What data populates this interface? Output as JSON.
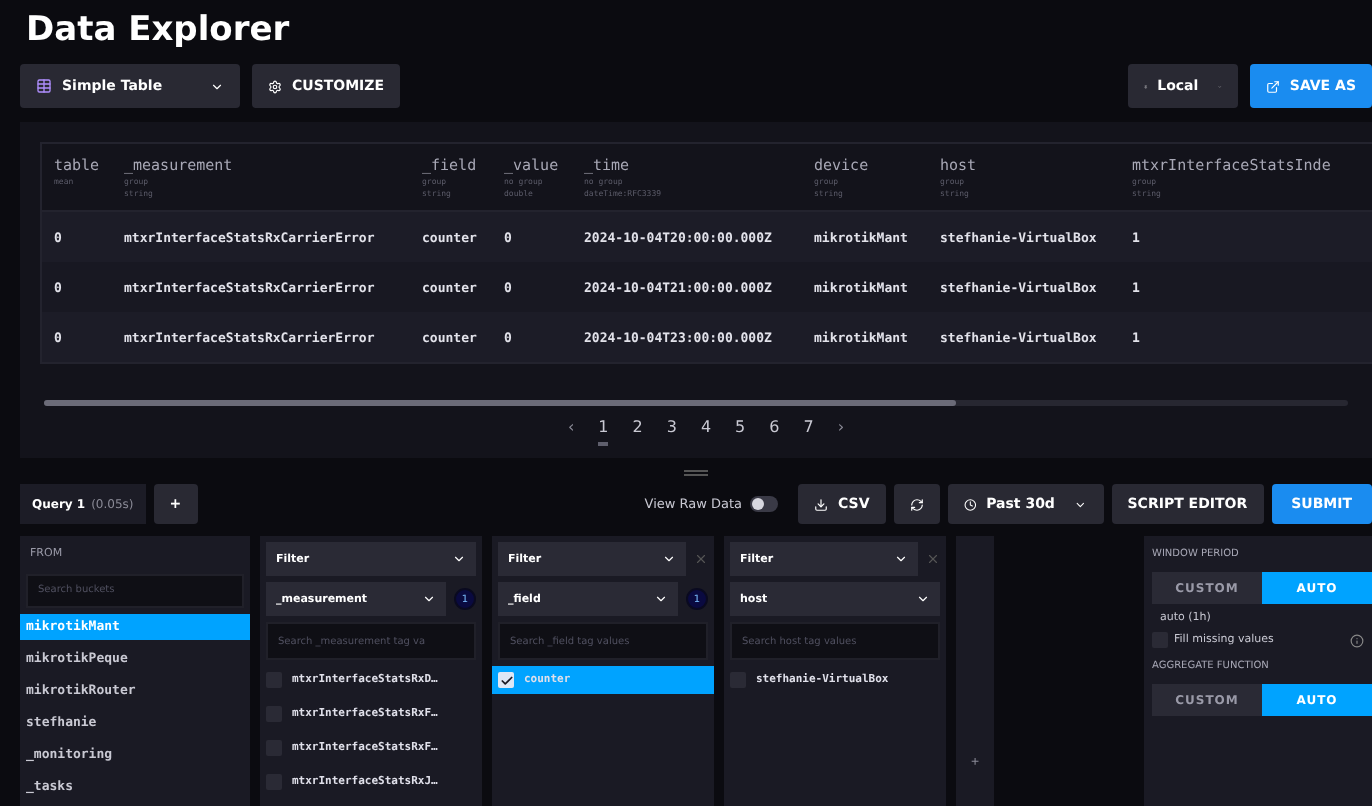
{
  "title": "Data Explorer",
  "toolbar": {
    "view_type": "Simple Table",
    "customize": "CUSTOMIZE",
    "timezone": "Local",
    "save_as": "SAVE AS"
  },
  "table": {
    "columns": [
      {
        "name": "table",
        "meta": [
          "mean"
        ]
      },
      {
        "name": "_measurement",
        "meta": [
          "group",
          "string"
        ]
      },
      {
        "name": "_field",
        "meta": [
          "group",
          "string"
        ]
      },
      {
        "name": "_value",
        "meta": [
          "no group",
          "double"
        ]
      },
      {
        "name": "_time",
        "meta": [
          "no group",
          "dateTime:RFC3339"
        ]
      },
      {
        "name": "device",
        "meta": [
          "group",
          "string"
        ]
      },
      {
        "name": "host",
        "meta": [
          "group",
          "string"
        ]
      },
      {
        "name": "mtxrInterfaceStatsInde",
        "meta": [
          "group",
          "string"
        ]
      }
    ],
    "rows": [
      [
        "0",
        "mtxrInterfaceStatsRxCarrierError",
        "counter",
        "0",
        "2024-10-04T20:00:00.000Z",
        "mikrotikMant",
        "stefhanie-VirtualBox",
        "1"
      ],
      [
        "0",
        "mtxrInterfaceStatsRxCarrierError",
        "counter",
        "0",
        "2024-10-04T21:00:00.000Z",
        "mikrotikMant",
        "stefhanie-VirtualBox",
        "1"
      ],
      [
        "0",
        "mtxrInterfaceStatsRxCarrierError",
        "counter",
        "0",
        "2024-10-04T23:00:00.000Z",
        "mikrotikMant",
        "stefhanie-VirtualBox",
        "1"
      ]
    ]
  },
  "pagination": {
    "prev": "‹",
    "next": "›",
    "pages": [
      {
        "label": "1",
        "selected": true
      },
      {
        "label": "2",
        "selected": false
      },
      {
        "label": "3",
        "selected": false
      },
      {
        "label": "4",
        "selected": false
      },
      {
        "label": "5",
        "selected": false
      },
      {
        "label": "6",
        "selected": false
      },
      {
        "label": "7",
        "selected": false
      }
    ]
  },
  "query_bar": {
    "tabs": [
      {
        "label": "Query 1",
        "timing": "(0.05s)",
        "selected": true
      }
    ],
    "add": "+",
    "view_raw_data": {
      "label": "View Raw Data",
      "on": false
    },
    "csv": "CSV",
    "time_range": "Past 30d",
    "script_editor": "SCRIPT EDITOR",
    "submit": "SUBMIT"
  },
  "from": {
    "title": "FROM",
    "placeholder": "Search buckets",
    "buckets": [
      {
        "label": "mikrotikMant",
        "selected": true
      },
      {
        "label": "mikrotikPeque",
        "selected": false
      },
      {
        "label": "mikrotikRouter",
        "selected": false
      },
      {
        "label": "stefhanie",
        "selected": false
      },
      {
        "label": "_monitoring",
        "selected": false
      },
      {
        "label": "_tasks",
        "selected": false
      }
    ]
  },
  "filters": [
    {
      "title": "Filter",
      "key": "_measurement",
      "count": "1",
      "placeholder": "Search _measurement tag va",
      "closable": false,
      "values": [
        {
          "label": "mtxrInterfaceStatsRxD…",
          "checked": false
        },
        {
          "label": "mtxrInterfaceStatsRxF…",
          "checked": false
        },
        {
          "label": "mtxrInterfaceStatsRxF…",
          "checked": false
        },
        {
          "label": "mtxrInterfaceStatsRxJ…",
          "checked": false
        }
      ]
    },
    {
      "title": "Filter",
      "key": "_field",
      "count": "1",
      "placeholder": "Search _field tag values",
      "closable": true,
      "values": [
        {
          "label": "counter",
          "checked": true
        }
      ]
    },
    {
      "title": "Filter",
      "key": "host",
      "placeholder": "Search host tag values",
      "closable": true,
      "values": [
        {
          "label": "stefhanie-VirtualBox",
          "checked": false
        }
      ]
    }
  ],
  "add_filter": "+",
  "window_period": {
    "title": "WINDOW PERIOD",
    "options": [
      {
        "label": "CUSTOM",
        "selected": false
      },
      {
        "label": "AUTO",
        "selected": true
      }
    ],
    "value": "auto (1h)",
    "fill_missing": {
      "label": "Fill missing values",
      "checked": false
    }
  },
  "aggregate": {
    "title": "AGGREGATE FUNCTION",
    "options": [
      {
        "label": "CUSTOM",
        "selected": false
      },
      {
        "label": "AUTO",
        "selected": true
      }
    ]
  }
}
